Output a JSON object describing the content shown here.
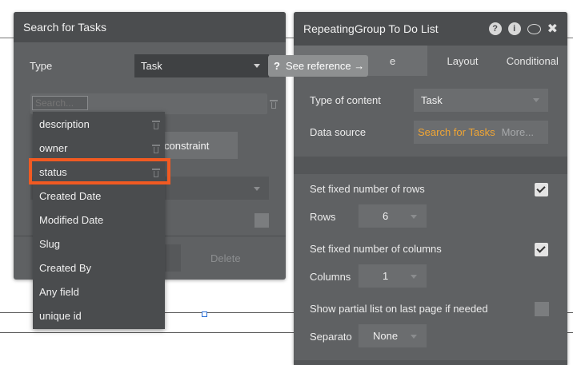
{
  "search_panel": {
    "title": "Search for Tasks",
    "type_label": "Type",
    "type_value": "Task",
    "see_reference": "See reference →",
    "see_reference_icon": "?",
    "search_placeholder": "Search...",
    "constraint_label": "constraint",
    "delete_label": "Delete",
    "field_list": [
      "description",
      "owner",
      "status",
      "Created Date",
      "Modified Date",
      "Slug",
      "Created By",
      "Any field",
      "unique id"
    ],
    "highlighted_field": "status",
    "highlight_color": "#f15a22"
  },
  "repeating_group_panel": {
    "title": "RepeatingGroup To Do List",
    "header_icons": {
      "help": "?",
      "info": "i",
      "comment": "comment-icon",
      "close": "✖"
    },
    "tabs": [
      {
        "label": "e",
        "active": true
      },
      {
        "label": "Layout",
        "active": false
      },
      {
        "label": "Conditional",
        "active": false
      }
    ],
    "type_of_content_label": "Type of content",
    "type_of_content_value": "Task",
    "data_source_label": "Data source",
    "data_source_value": "Search for Tasks",
    "data_source_more": "More...",
    "fixed_rows_label": "Set fixed number of rows",
    "fixed_rows_checked": true,
    "rows_label": "Rows",
    "rows_value": "6",
    "fixed_columns_label": "Set fixed number of columns",
    "fixed_columns_checked": true,
    "columns_label": "Columns",
    "columns_value": "1",
    "partial_list_label": "Show partial list on last page if needed",
    "partial_list_checked": false,
    "separator_label": "Separato",
    "separator_value": "None",
    "accent_color": "#f0a534"
  }
}
